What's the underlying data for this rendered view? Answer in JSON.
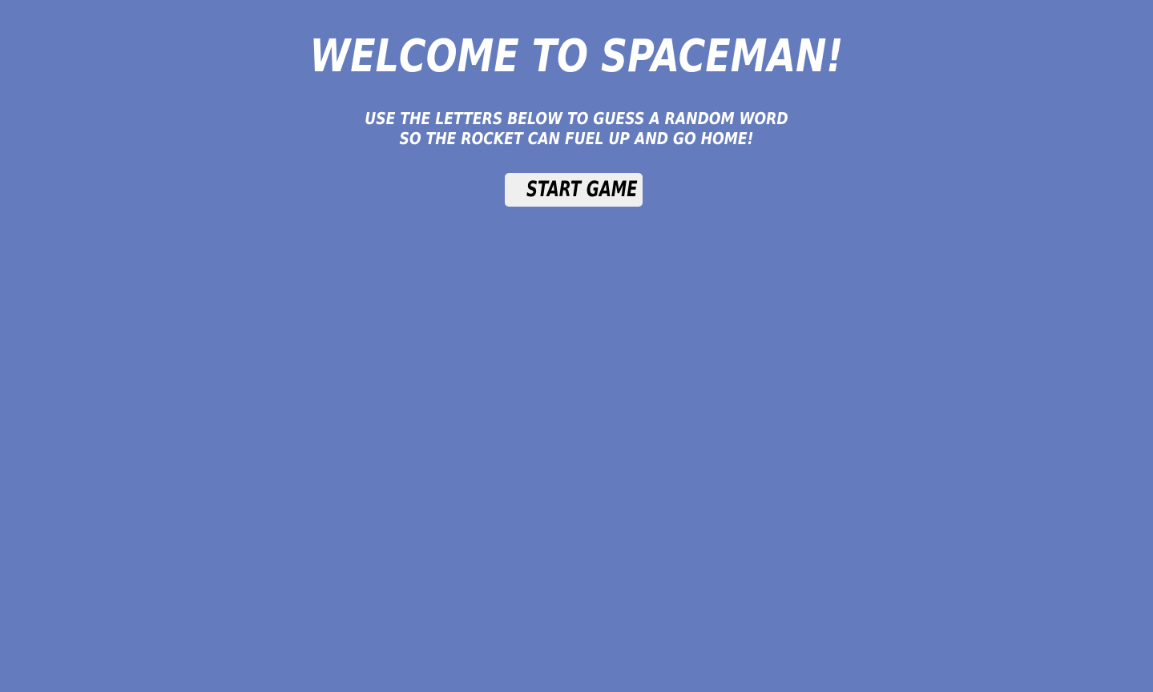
{
  "colors": {
    "background": "#647cbd",
    "title_text": "#ffffff",
    "button_background": "#efefef",
    "button_text": "#000000"
  },
  "title": "WELCOME TO SPACEMAN!",
  "instructions": {
    "line1": "USE THE LETTERS BELOW TO GUESS A RANDOM WORD",
    "line2": "SO THE ROCKET CAN FUEL UP AND GO HOME!"
  },
  "start_button": {
    "label": "START GAME"
  }
}
